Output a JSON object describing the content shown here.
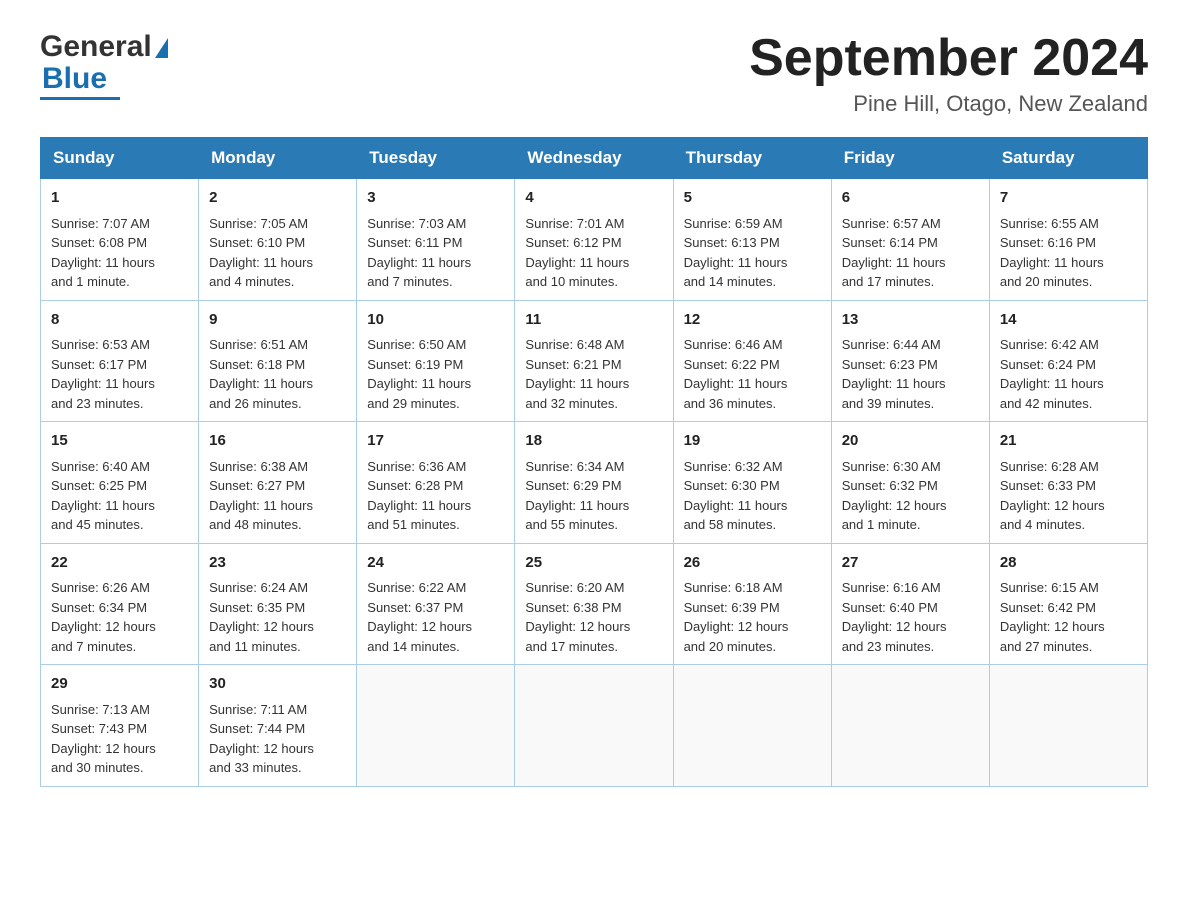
{
  "header": {
    "logo_text_general": "General",
    "logo_text_blue": "Blue",
    "month_year": "September 2024",
    "location": "Pine Hill, Otago, New Zealand"
  },
  "days_of_week": [
    "Sunday",
    "Monday",
    "Tuesday",
    "Wednesday",
    "Thursday",
    "Friday",
    "Saturday"
  ],
  "weeks": [
    [
      {
        "day": "1",
        "lines": [
          "Sunrise: 7:07 AM",
          "Sunset: 6:08 PM",
          "Daylight: 11 hours",
          "and 1 minute."
        ]
      },
      {
        "day": "2",
        "lines": [
          "Sunrise: 7:05 AM",
          "Sunset: 6:10 PM",
          "Daylight: 11 hours",
          "and 4 minutes."
        ]
      },
      {
        "day": "3",
        "lines": [
          "Sunrise: 7:03 AM",
          "Sunset: 6:11 PM",
          "Daylight: 11 hours",
          "and 7 minutes."
        ]
      },
      {
        "day": "4",
        "lines": [
          "Sunrise: 7:01 AM",
          "Sunset: 6:12 PM",
          "Daylight: 11 hours",
          "and 10 minutes."
        ]
      },
      {
        "day": "5",
        "lines": [
          "Sunrise: 6:59 AM",
          "Sunset: 6:13 PM",
          "Daylight: 11 hours",
          "and 14 minutes."
        ]
      },
      {
        "day": "6",
        "lines": [
          "Sunrise: 6:57 AM",
          "Sunset: 6:14 PM",
          "Daylight: 11 hours",
          "and 17 minutes."
        ]
      },
      {
        "day": "7",
        "lines": [
          "Sunrise: 6:55 AM",
          "Sunset: 6:16 PM",
          "Daylight: 11 hours",
          "and 20 minutes."
        ]
      }
    ],
    [
      {
        "day": "8",
        "lines": [
          "Sunrise: 6:53 AM",
          "Sunset: 6:17 PM",
          "Daylight: 11 hours",
          "and 23 minutes."
        ]
      },
      {
        "day": "9",
        "lines": [
          "Sunrise: 6:51 AM",
          "Sunset: 6:18 PM",
          "Daylight: 11 hours",
          "and 26 minutes."
        ]
      },
      {
        "day": "10",
        "lines": [
          "Sunrise: 6:50 AM",
          "Sunset: 6:19 PM",
          "Daylight: 11 hours",
          "and 29 minutes."
        ]
      },
      {
        "day": "11",
        "lines": [
          "Sunrise: 6:48 AM",
          "Sunset: 6:21 PM",
          "Daylight: 11 hours",
          "and 32 minutes."
        ]
      },
      {
        "day": "12",
        "lines": [
          "Sunrise: 6:46 AM",
          "Sunset: 6:22 PM",
          "Daylight: 11 hours",
          "and 36 minutes."
        ]
      },
      {
        "day": "13",
        "lines": [
          "Sunrise: 6:44 AM",
          "Sunset: 6:23 PM",
          "Daylight: 11 hours",
          "and 39 minutes."
        ]
      },
      {
        "day": "14",
        "lines": [
          "Sunrise: 6:42 AM",
          "Sunset: 6:24 PM",
          "Daylight: 11 hours",
          "and 42 minutes."
        ]
      }
    ],
    [
      {
        "day": "15",
        "lines": [
          "Sunrise: 6:40 AM",
          "Sunset: 6:25 PM",
          "Daylight: 11 hours",
          "and 45 minutes."
        ]
      },
      {
        "day": "16",
        "lines": [
          "Sunrise: 6:38 AM",
          "Sunset: 6:27 PM",
          "Daylight: 11 hours",
          "and 48 minutes."
        ]
      },
      {
        "day": "17",
        "lines": [
          "Sunrise: 6:36 AM",
          "Sunset: 6:28 PM",
          "Daylight: 11 hours",
          "and 51 minutes."
        ]
      },
      {
        "day": "18",
        "lines": [
          "Sunrise: 6:34 AM",
          "Sunset: 6:29 PM",
          "Daylight: 11 hours",
          "and 55 minutes."
        ]
      },
      {
        "day": "19",
        "lines": [
          "Sunrise: 6:32 AM",
          "Sunset: 6:30 PM",
          "Daylight: 11 hours",
          "and 58 minutes."
        ]
      },
      {
        "day": "20",
        "lines": [
          "Sunrise: 6:30 AM",
          "Sunset: 6:32 PM",
          "Daylight: 12 hours",
          "and 1 minute."
        ]
      },
      {
        "day": "21",
        "lines": [
          "Sunrise: 6:28 AM",
          "Sunset: 6:33 PM",
          "Daylight: 12 hours",
          "and 4 minutes."
        ]
      }
    ],
    [
      {
        "day": "22",
        "lines": [
          "Sunrise: 6:26 AM",
          "Sunset: 6:34 PM",
          "Daylight: 12 hours",
          "and 7 minutes."
        ]
      },
      {
        "day": "23",
        "lines": [
          "Sunrise: 6:24 AM",
          "Sunset: 6:35 PM",
          "Daylight: 12 hours",
          "and 11 minutes."
        ]
      },
      {
        "day": "24",
        "lines": [
          "Sunrise: 6:22 AM",
          "Sunset: 6:37 PM",
          "Daylight: 12 hours",
          "and 14 minutes."
        ]
      },
      {
        "day": "25",
        "lines": [
          "Sunrise: 6:20 AM",
          "Sunset: 6:38 PM",
          "Daylight: 12 hours",
          "and 17 minutes."
        ]
      },
      {
        "day": "26",
        "lines": [
          "Sunrise: 6:18 AM",
          "Sunset: 6:39 PM",
          "Daylight: 12 hours",
          "and 20 minutes."
        ]
      },
      {
        "day": "27",
        "lines": [
          "Sunrise: 6:16 AM",
          "Sunset: 6:40 PM",
          "Daylight: 12 hours",
          "and 23 minutes."
        ]
      },
      {
        "day": "28",
        "lines": [
          "Sunrise: 6:15 AM",
          "Sunset: 6:42 PM",
          "Daylight: 12 hours",
          "and 27 minutes."
        ]
      }
    ],
    [
      {
        "day": "29",
        "lines": [
          "Sunrise: 7:13 AM",
          "Sunset: 7:43 PM",
          "Daylight: 12 hours",
          "and 30 minutes."
        ]
      },
      {
        "day": "30",
        "lines": [
          "Sunrise: 7:11 AM",
          "Sunset: 7:44 PM",
          "Daylight: 12 hours",
          "and 33 minutes."
        ]
      },
      null,
      null,
      null,
      null,
      null
    ]
  ]
}
